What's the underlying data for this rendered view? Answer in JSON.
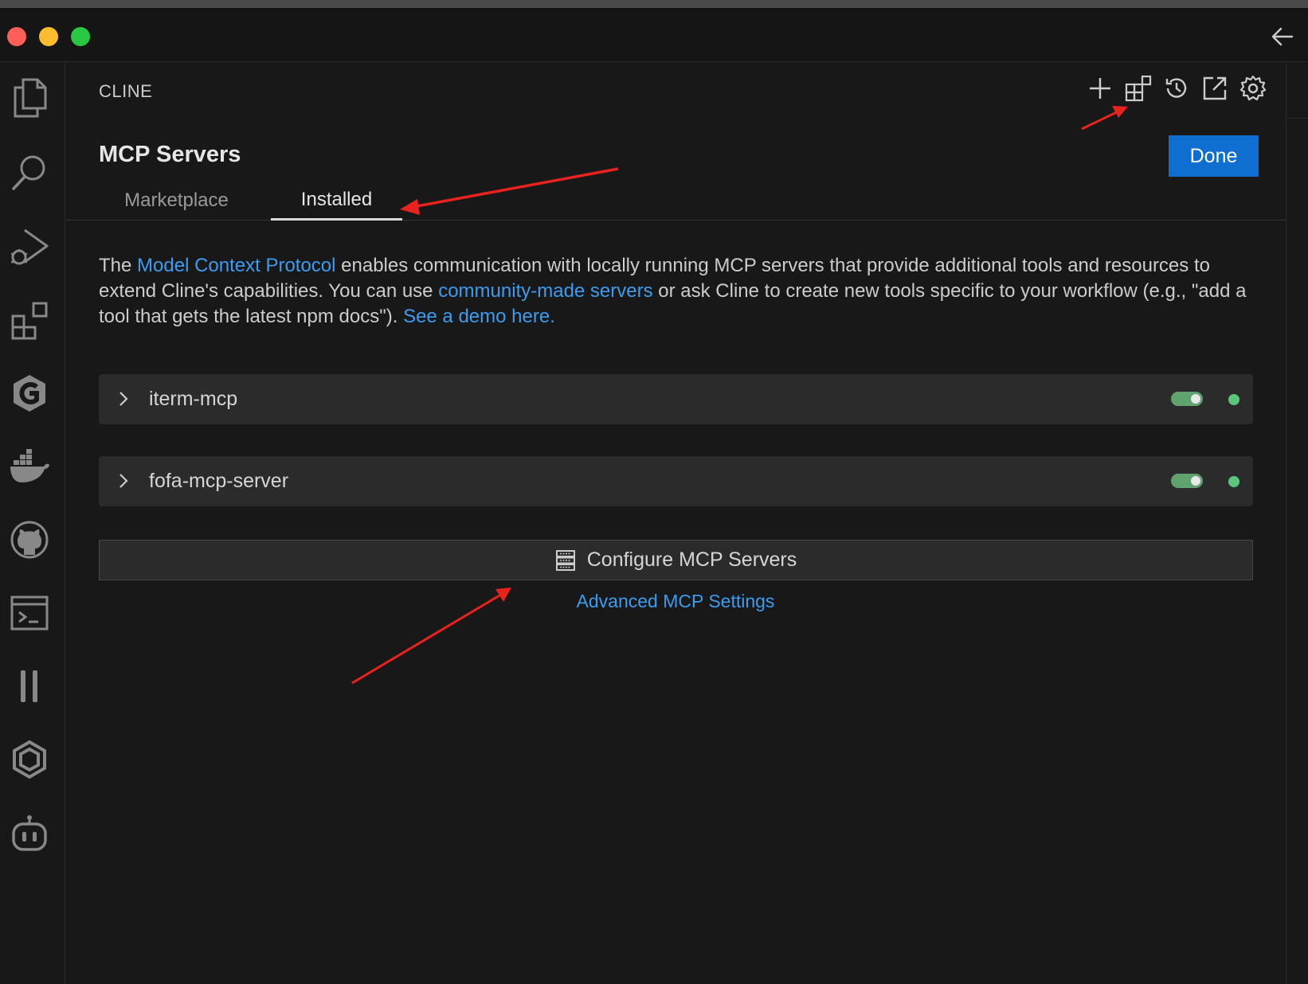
{
  "window": {
    "traffic_lights": {
      "close": "#ff5f57",
      "minimize": "#febc2e",
      "maximize": "#28c840"
    }
  },
  "activity_bar": {
    "items": [
      "explorer-icon",
      "search-icon",
      "run-debug-icon",
      "extensions-icon",
      "gitlens-icon",
      "docker-icon",
      "github-icon",
      "terminal-icon",
      "pause-icon",
      "kubernetes-icon",
      "copilot-icon"
    ]
  },
  "panel": {
    "title": "CLINE",
    "header_icons": [
      "plus-icon",
      "mcp-servers-icon",
      "history-icon",
      "popout-icon",
      "gear-icon"
    ],
    "page_title": "MCP Servers",
    "done_label": "Done",
    "tabs": [
      {
        "label": "Marketplace",
        "active": false
      },
      {
        "label": "Installed",
        "active": true
      }
    ],
    "description": {
      "p1": "The ",
      "link1": "Model Context Protocol",
      "p2": " enables communication with locally running MCP servers that provide additional tools and resources to extend Cline's capabilities. You can use ",
      "link2": "community-made servers",
      "p3": " or ask Cline to create new tools specific to your workflow (e.g., \"add a tool that gets the latest npm docs\"). ",
      "link3": "See a demo here."
    },
    "servers": [
      {
        "name": "iterm-mcp",
        "enabled": true,
        "status_color": "#5cc47c"
      },
      {
        "name": "fofa-mcp-server",
        "enabled": true,
        "status_color": "#5cc47c"
      }
    ],
    "configure_label": "Configure MCP Servers",
    "advanced_label": "Advanced MCP Settings"
  },
  "colors": {
    "accent": "#0e6fd0",
    "link": "#3b9cf0",
    "annotation": "#e8221c"
  }
}
